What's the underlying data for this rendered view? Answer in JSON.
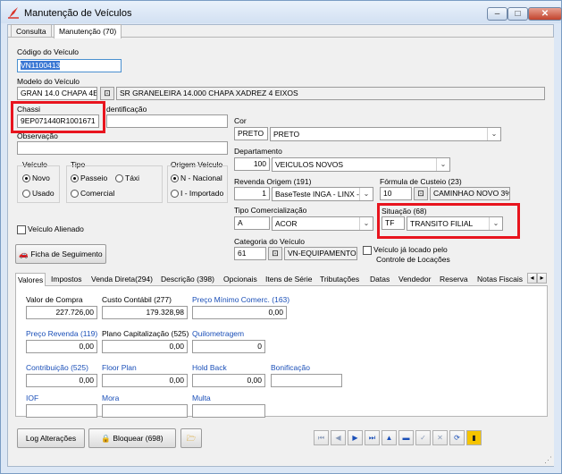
{
  "window": {
    "title": "Manutenção de Veículos",
    "minimize": "–",
    "maximize": "□",
    "close": "✕"
  },
  "tabs": [
    "Consulta",
    "Manutenção (70)"
  ],
  "form": {
    "codigo": {
      "label": "Código do Veículo",
      "value": "VN1100413"
    },
    "modelo": {
      "label": "Modelo do Veículo",
      "value": "GRAN 14.0 CHAPA 4E",
      "desc": "SR GRANELEIRA 14.000 CHAPA XADREZ 4 EIXOS"
    },
    "chassi": {
      "label": "Chassi",
      "value": "9EP071440R1001671"
    },
    "identificacao": {
      "label": "dentificação",
      "value": ""
    },
    "observacao": {
      "label": "Observação",
      "value": ""
    },
    "veiculo": {
      "label": "Veículo",
      "opt1": "Novo",
      "opt2": "Usado"
    },
    "tipo": {
      "label": "Tipo",
      "opt1": "Passeio",
      "opt2": "Táxi",
      "opt3": "Comercial"
    },
    "origem": {
      "label": "Origem Veículo",
      "opt1": "N - Nacional",
      "opt2": "I - Importado"
    },
    "alienado": "Veículo Alienado",
    "ficha": "Ficha de Seguimento",
    "cor": {
      "label": "Cor",
      "code": "PRETO",
      "value": "PRETO"
    },
    "departamento": {
      "label": "Departamento",
      "code": "100",
      "value": "VEICULOS NOVOS"
    },
    "revenda": {
      "label": "Revenda Origem (191)",
      "code": "1",
      "value": "BaseTeste INGA - LINX -"
    },
    "formula": {
      "label": "Fórmula de Custeio (23)",
      "code": "10",
      "value": "CAMINHAO NOVO 3%"
    },
    "tipoComercial": {
      "label": "Tipo Comercialização",
      "code": "A",
      "value": "ACOR"
    },
    "situacao": {
      "label": "Situação (68)",
      "code": "TF",
      "value": "TRANSITO FILIAL"
    },
    "categoria": {
      "label": "Categoria do Veículo",
      "code": "61",
      "value": "VN-EQUIPAMENTOS/I"
    },
    "locado": {
      "line1": "Veículo já locado pelo",
      "line2": "Controle de Locações"
    }
  },
  "subtabs": [
    "Valores",
    "Impostos",
    "Venda Direta(294)",
    "Descrição (398)",
    "Opcionais",
    "Itens de Série",
    "Tributações",
    "Datas",
    "Vendedor",
    "Reserva",
    "Notas Fiscais"
  ],
  "valores": {
    "valorCompra": {
      "label": "Valor de Compra",
      "value": "227.726,00"
    },
    "custoContabil": {
      "label": "Custo Contábil (277)",
      "value": "179.328,98"
    },
    "precoMinimo": {
      "label": "Preço Mínimo Comerc. (163)",
      "value": "0,00"
    },
    "precoRevenda": {
      "label": "Preço Revenda (119)",
      "value": "0,00"
    },
    "planoCap": {
      "label": "Plano Capitalização (525)",
      "value": "0,00"
    },
    "quilometragem": {
      "label": "Quilometragem",
      "value": "0"
    },
    "contribuicao": {
      "label": "Contribuição (525)",
      "value": "0,00"
    },
    "floorPlan": {
      "label": "Floor Plan",
      "value": "0,00"
    },
    "holdBack": {
      "label": "Hold Back",
      "value": "0,00"
    },
    "bonificacao": {
      "label": "Bonificação",
      "value": ""
    },
    "iof": {
      "label": "IOF",
      "value": ""
    },
    "mora": {
      "label": "Mora",
      "value": ""
    },
    "multa": {
      "label": "Multa",
      "value": ""
    }
  },
  "bottom": {
    "log": "Log Alterações",
    "bloquear": "Bloquear (698)"
  },
  "colors": {
    "highlight": "#e8141e",
    "blueLabel": "#1a4fb8"
  }
}
